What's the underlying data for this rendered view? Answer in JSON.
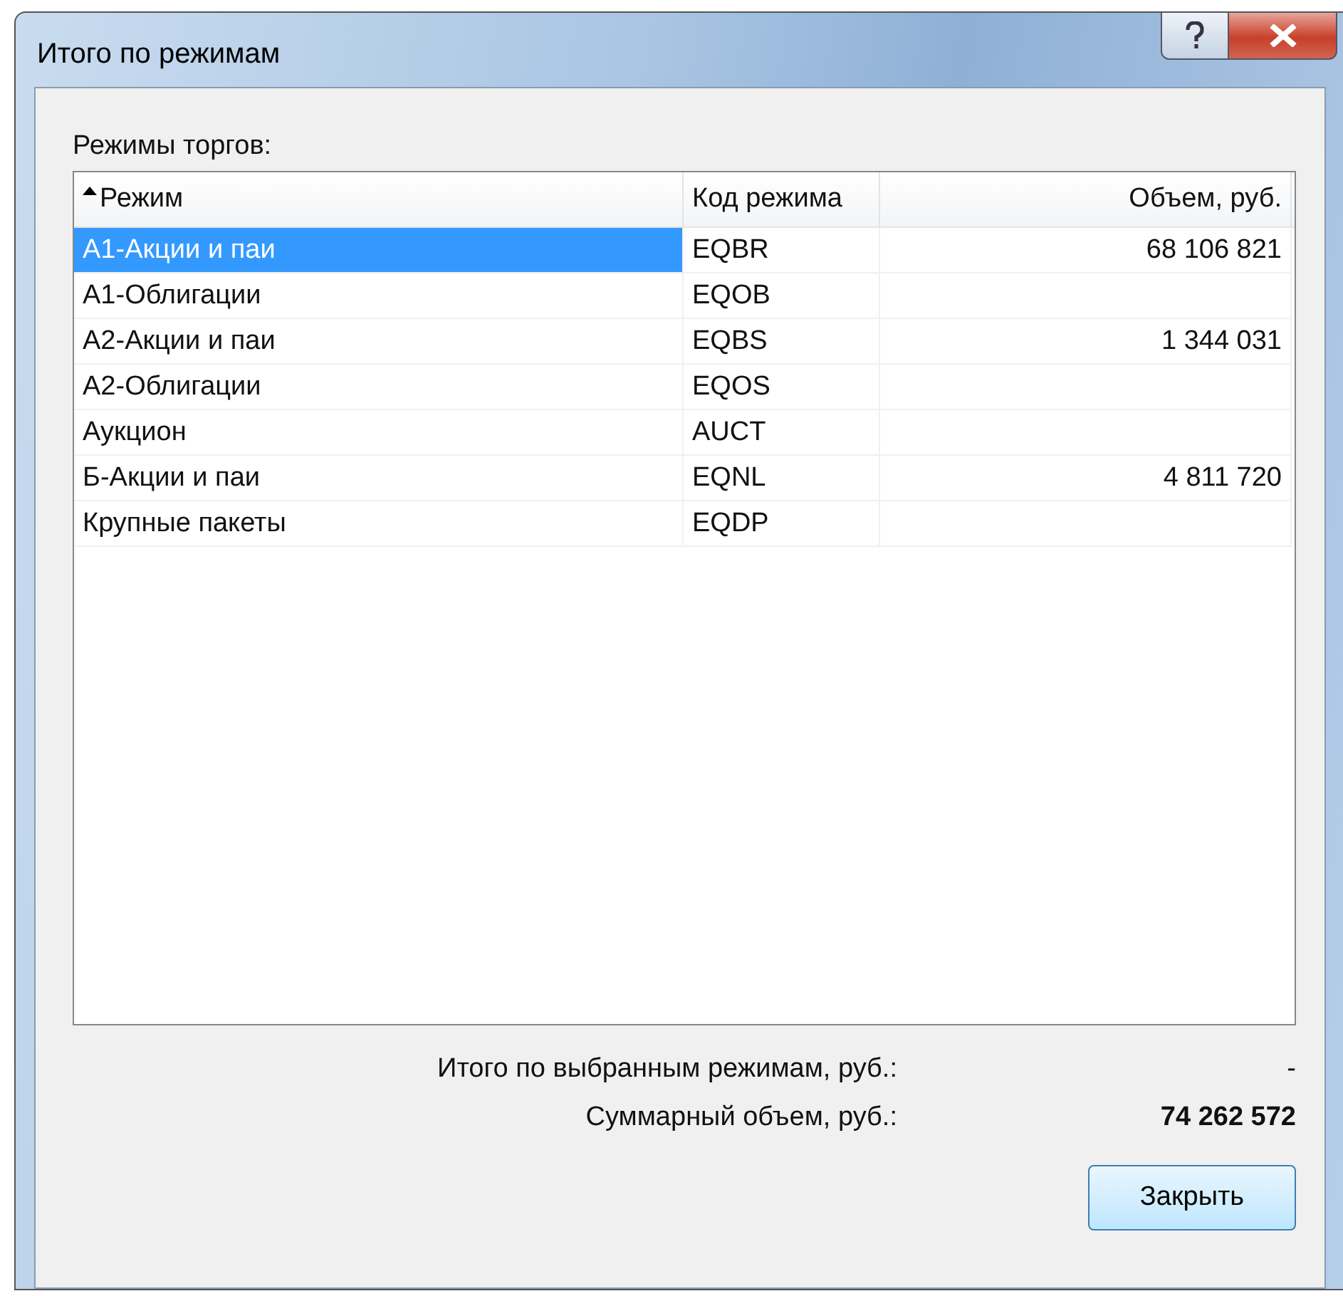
{
  "window": {
    "title": "Итого по режимам"
  },
  "list_label": "Режимы торгов:",
  "table": {
    "columns": [
      {
        "label": "Режим",
        "sorted": true
      },
      {
        "label": "Код режима",
        "sorted": false
      },
      {
        "label": "Объем, руб.",
        "sorted": false
      }
    ],
    "rows": [
      {
        "cells": [
          "А1-Акции и паи",
          "EQBR",
          "68 106 821"
        ],
        "selected": true
      },
      {
        "cells": [
          "А1-Облигации",
          "EQOB",
          ""
        ],
        "selected": false
      },
      {
        "cells": [
          "А2-Акции и паи",
          "EQBS",
          "1 344 031"
        ],
        "selected": false
      },
      {
        "cells": [
          "А2-Облигации",
          "EQOS",
          ""
        ],
        "selected": false
      },
      {
        "cells": [
          "Аукцион",
          "AUCT",
          ""
        ],
        "selected": false
      },
      {
        "cells": [
          "Б-Акции и паи",
          "EQNL",
          "4 811 720"
        ],
        "selected": false
      },
      {
        "cells": [
          "Крупные пакеты",
          "EQDP",
          ""
        ],
        "selected": false
      }
    ]
  },
  "totals": [
    {
      "label": "Итого по выбранным режимам, руб.:",
      "value": "-",
      "bold": false
    },
    {
      "label": "Суммарный объем, руб.:",
      "value": "74 262 572",
      "bold": true
    }
  ],
  "buttons": [
    "Закрыть"
  ]
}
